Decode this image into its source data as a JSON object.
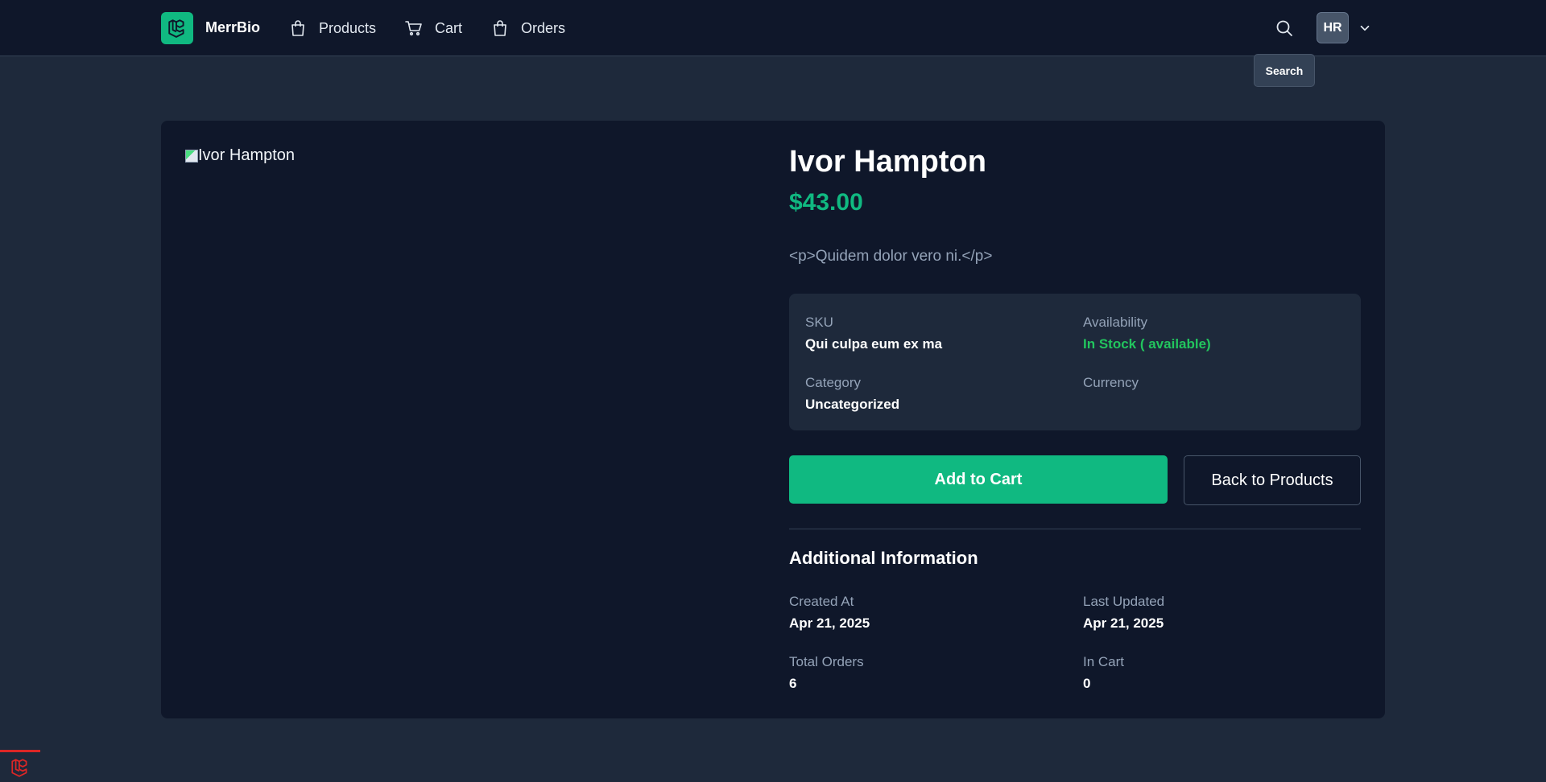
{
  "nav": {
    "brand": "MerrBio",
    "links": [
      {
        "label": "Products",
        "icon": "shopping-bag-icon"
      },
      {
        "label": "Cart",
        "icon": "cart-icon"
      },
      {
        "label": "Orders",
        "icon": "shopping-bag-icon"
      }
    ],
    "search_tooltip": "Search",
    "user_initials": "HR"
  },
  "product": {
    "image_alt": "Ivor Hampton",
    "name": "Ivor Hampton",
    "price": "$43.00",
    "description": "<p>Quidem dolor vero ni.</p>",
    "details": {
      "sku_label": "SKU",
      "sku_value": "Qui culpa eum ex ma",
      "availability_label": "Availability",
      "availability_value": "In Stock ( available)",
      "category_label": "Category",
      "category_value": "Uncategorized",
      "currency_label": "Currency",
      "currency_value": ""
    },
    "actions": {
      "add_to_cart": "Add to Cart",
      "back": "Back to Products"
    },
    "additional": {
      "title": "Additional Information",
      "created_label": "Created At",
      "created_value": "Apr 21, 2025",
      "updated_label": "Last Updated",
      "updated_value": "Apr 21, 2025",
      "orders_label": "Total Orders",
      "orders_value": "6",
      "incart_label": "In Cart",
      "incart_value": "0"
    }
  },
  "colors": {
    "accent": "#10b981",
    "background": "#1e293b",
    "surface": "#0f172a",
    "stock_green": "#22c55e"
  }
}
